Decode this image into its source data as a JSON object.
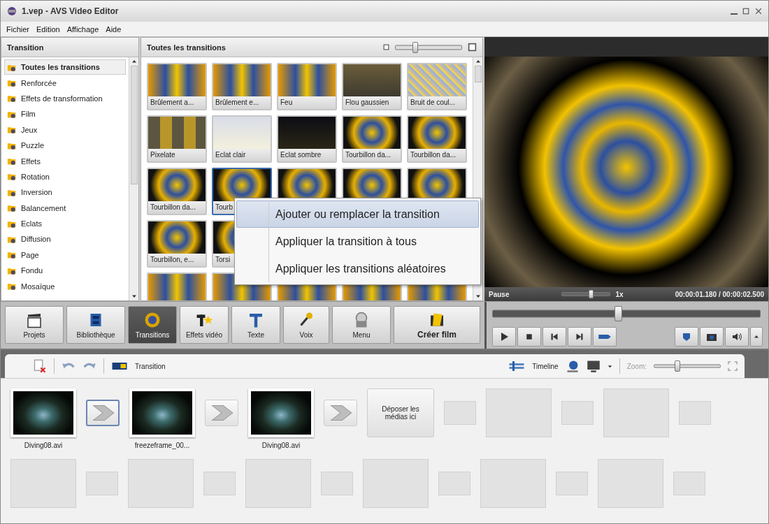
{
  "window": {
    "title": "1.vep - AVS Video Editor"
  },
  "menu": [
    "Fichier",
    "Edition",
    "Affichage",
    "Aide"
  ],
  "categories": {
    "title": "Transition",
    "items": [
      {
        "label": "Toutes les transitions",
        "selected": true
      },
      {
        "label": "Renforcée",
        "selected": false
      },
      {
        "label": "Effets de transformation",
        "selected": false
      },
      {
        "label": "Film",
        "selected": false
      },
      {
        "label": "Jeux",
        "selected": false
      },
      {
        "label": "Puzzle",
        "selected": false
      },
      {
        "label": "Effets",
        "selected": false
      },
      {
        "label": "Rotation",
        "selected": false
      },
      {
        "label": "Inversion",
        "selected": false
      },
      {
        "label": "Balancement",
        "selected": false
      },
      {
        "label": "Eclats",
        "selected": false
      },
      {
        "label": "Diffusion",
        "selected": false
      },
      {
        "label": "Page",
        "selected": false
      },
      {
        "label": "Fondu",
        "selected": false
      },
      {
        "label": "Mosaïque",
        "selected": false
      }
    ]
  },
  "gallery": {
    "title": "Toutes les transitions",
    "size_slider": {
      "level": 0.3
    },
    "rows": [
      [
        {
          "label": "Brûlement a...",
          "selected": false
        },
        {
          "label": "Brûlement e...",
          "selected": false
        },
        {
          "label": "Feu",
          "selected": false
        },
        {
          "label": "Flou gaussien",
          "selected": false
        },
        {
          "label": "Bruit de coul...",
          "selected": false
        }
      ],
      [
        {
          "label": "Pixelate",
          "selected": false
        },
        {
          "label": "Eclat clair",
          "selected": false
        },
        {
          "label": "Eclat sombre",
          "selected": false
        },
        {
          "label": "Tourbillon da...",
          "selected": false
        },
        {
          "label": "Tourbillon da...",
          "selected": false
        }
      ],
      [
        {
          "label": "Tourbillon da...",
          "selected": false
        },
        {
          "label": "Tourb",
          "selected": true
        },
        {
          "selected": false
        },
        {
          "selected": false
        },
        {
          "selected": false
        }
      ],
      [
        {
          "label": "Tourbillon, e...",
          "selected": false
        },
        {
          "label": "Torsi",
          "selected": false
        }
      ],
      [
        {
          "selected": false
        },
        {
          "selected": false
        },
        {
          "selected": false
        },
        {
          "selected": false
        },
        {
          "selected": false
        }
      ]
    ]
  },
  "context_menu": [
    {
      "label": "Ajouter ou remplacer la transition",
      "selected": true
    },
    {
      "label": "Appliquer la transition à tous",
      "selected": false
    },
    {
      "label": "Appliquer les transitions aléatoires",
      "selected": false
    }
  ],
  "preview": {
    "status": "Pause",
    "speed": "1x",
    "speed_slider": {
      "level": 0.62
    },
    "time": "00:00:01.180 / 00:00:02.500",
    "seek": {
      "level": 0.47
    }
  },
  "toolbar": [
    {
      "label": "Projets",
      "selected": false
    },
    {
      "label": "Bibliothèque",
      "selected": false
    },
    {
      "label": "Transitions",
      "selected": true
    },
    {
      "label": "Effets vidéo",
      "selected": false
    },
    {
      "label": "Texte",
      "selected": false
    },
    {
      "label": "Voix",
      "selected": false
    },
    {
      "label": "Menu",
      "selected": false
    },
    {
      "label": "Créer film",
      "selected": false
    }
  ],
  "storyboard": {
    "mode": "Transition",
    "view": "Timeline",
    "zoom_label": "Zoom:",
    "zoom": {
      "level": 0.35
    },
    "rows": [
      [
        {
          "kind": "clip",
          "name": "Diving08.avi"
        },
        {
          "kind": "transition",
          "selected": true
        },
        {
          "kind": "clip",
          "name": "freezeframe_00..."
        },
        {
          "kind": "transition",
          "selected": false
        },
        {
          "kind": "clip",
          "name": "Diving08.avi"
        },
        {
          "kind": "transition",
          "selected": false
        },
        {
          "kind": "drop",
          "text": "Déposer les médias ici"
        },
        {
          "kind": "empty_transition"
        },
        {
          "kind": "empty_clip"
        },
        {
          "kind": "empty_transition"
        },
        {
          "kind": "empty_clip"
        },
        {
          "kind": "empty_transition"
        }
      ],
      [
        {
          "kind": "empty_clip"
        },
        {
          "kind": "empty_transition"
        },
        {
          "kind": "empty_clip"
        },
        {
          "kind": "empty_transition"
        },
        {
          "kind": "empty_clip"
        },
        {
          "kind": "empty_transition"
        },
        {
          "kind": "empty_clip"
        },
        {
          "kind": "empty_transition"
        },
        {
          "kind": "empty_clip"
        },
        {
          "kind": "empty_transition"
        },
        {
          "kind": "empty_clip"
        },
        {
          "kind": "empty_transition"
        }
      ]
    ]
  }
}
